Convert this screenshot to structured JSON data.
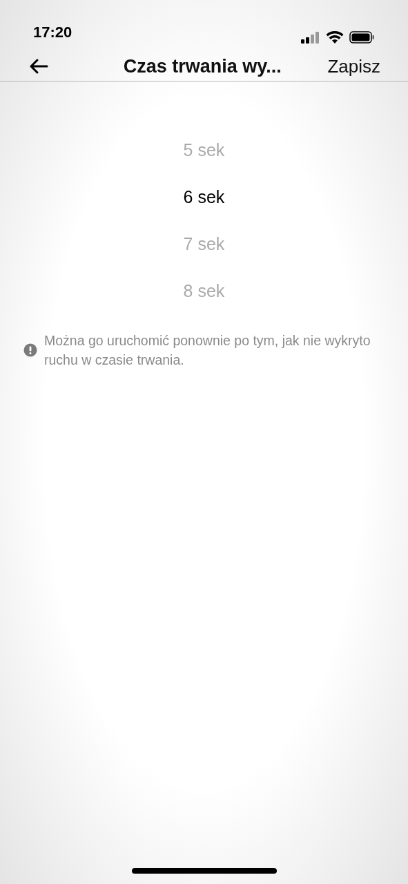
{
  "status_bar": {
    "time": "17:20"
  },
  "nav": {
    "title": "Czas trwania wy...",
    "action": "Zapisz"
  },
  "picker": [
    {
      "label": "5 sek",
      "selected": false
    },
    {
      "label": "6 sek",
      "selected": true
    },
    {
      "label": "7 sek",
      "selected": false
    },
    {
      "label": "8 sek",
      "selected": false
    }
  ],
  "note": "Można go uruchomić ponownie po tym, jak nie wykryto ruchu w czasie trwania."
}
